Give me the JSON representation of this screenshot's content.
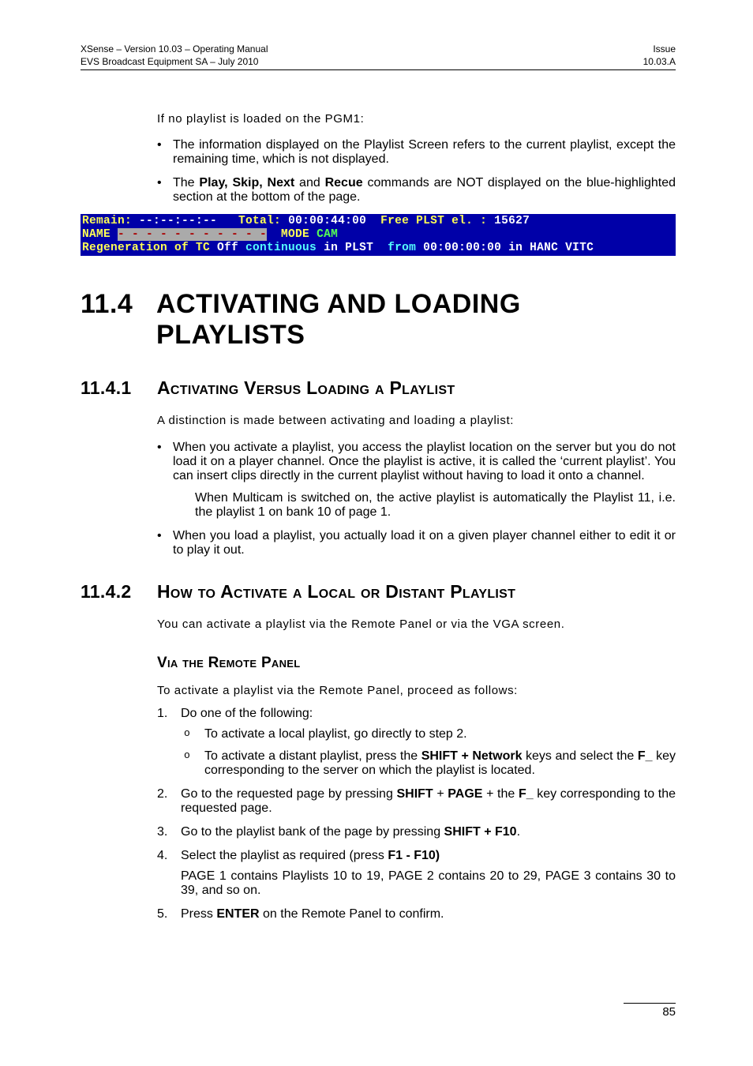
{
  "header": {
    "left_line1": "XSense – Version 10.03 – Operating Manual",
    "left_line2": "EVS Broadcast Equipment SA – July 2010",
    "right_line1": "Issue",
    "right_line2": "10.03.A"
  },
  "intro": "If no playlist is loaded on the PGM1:",
  "top_bullets": [
    {
      "pre": "The information displayed on the Playlist Screen refers to the current playlist, except the remaining time, which is not displayed."
    },
    {
      "pre": "The ",
      "bold": "Play, Skip, Next",
      "mid": " and ",
      "bold2": "Recue",
      "post": " commands are NOT displayed on the blue-highlighted section at the bottom of the page."
    }
  ],
  "screenshot": {
    "l1_a": "Remain:",
    "l1_b": " --:--:--:--   ",
    "l1_c": "Total:",
    "l1_d": " 00:00:44:00  ",
    "l1_e": "Free PLST el. :",
    "l1_f": " 15627",
    "l2_a": "NAME ",
    "l2_b": "- - - - - - - - - - -",
    "l2_c": "  MODE ",
    "l2_d": "CAM",
    "l3_a": "Regeneration of TC",
    "l3_b": " Off ",
    "l3_c": "continuous",
    "l3_d": " in PLST  ",
    "l3_e": "from",
    "l3_f": " 00:00:00:00 in HANC VITC"
  },
  "h1": {
    "num": "11.4",
    "text": "ACTIVATING AND LOADING PLAYLISTS"
  },
  "s1": {
    "num": "11.4.1",
    "title": "Activating Versus Loading a Playlist",
    "intro": "A distinction is made between activating and loading a playlist:",
    "b1": "When you activate a playlist, you access the playlist location on the server but you do not load it on a player channel. Once the playlist is active, it is called the ‘current playlist’. You can insert clips directly in the current playlist without having to load it onto a channel.",
    "b1_sub": "When Multicam is switched on, the active playlist is automatically the Playlist 11, i.e. the playlist 1 on bank 10 of page 1.",
    "b2": "When you load a playlist, you actually load it on a given player channel either to edit it or to play it out."
  },
  "s2": {
    "num": "11.4.2",
    "title": "How to Activate a Local or Distant Playlist",
    "intro": "You can activate a playlist via the Remote Panel or via the VGA screen.",
    "h3": "Via the Remote Panel",
    "lead": "To activate a playlist via the Remote Panel, proceed as follows:",
    "step1": "Do one of the following:",
    "step1a": "To activate a local playlist, go directly to step 2.",
    "step1b_pre": "To activate a distant playlist, press the ",
    "step1b_bold": "SHIFT + Network",
    "step1b_mid": " keys and select the ",
    "step1b_bold2": "F_",
    "step1b_post": " key corresponding to the server on which the playlist is located.",
    "step2_pre": "Go to the requested page by pressing ",
    "step2_b1": "SHIFT",
    "step2_plus1": " + ",
    "step2_b2": "PAGE",
    "step2_plus2": " + the ",
    "step2_b3": "F_",
    "step2_post": " key corresponding to the requested page.",
    "step3_pre": "Go to the playlist bank of the page by pressing ",
    "step3_bold": "SHIFT  +  F10",
    "step3_post": ".",
    "step4_pre": "Select the playlist as required (press ",
    "step4_bold": "F1 - F10)",
    "step4_note": "PAGE 1 contains Playlists 10 to 19, PAGE 2 contains 20 to 29, PAGE 3 contains 30 to 39, and so on.",
    "step5_pre": "Press ",
    "step5_bold": "ENTER",
    "step5_post": " on the Remote Panel to confirm."
  },
  "page_number": "85"
}
